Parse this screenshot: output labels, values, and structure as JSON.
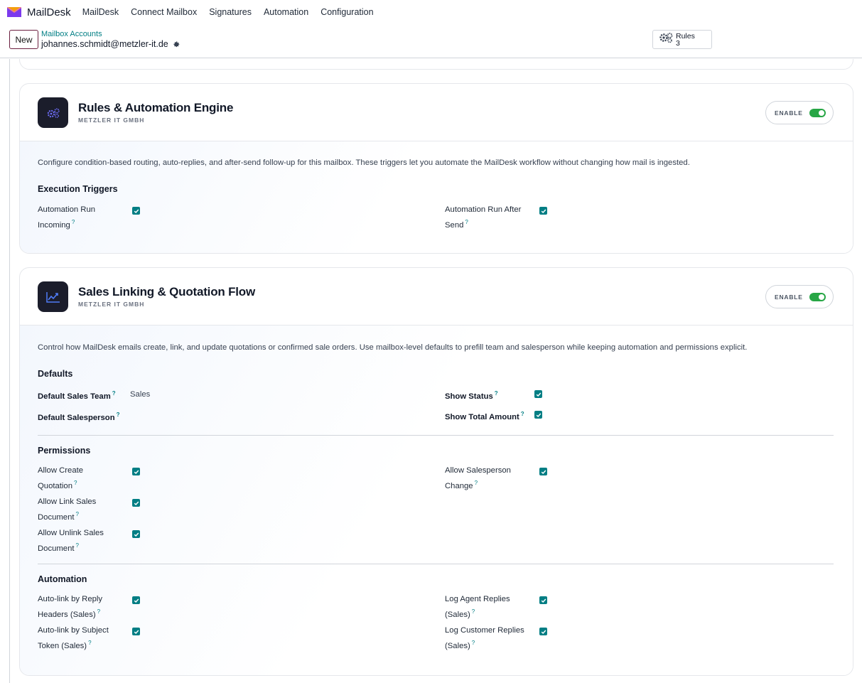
{
  "navbar": {
    "brand": "MailDesk",
    "items": [
      "MailDesk",
      "Connect Mailbox",
      "Signatures",
      "Automation",
      "Configuration"
    ]
  },
  "controlbar": {
    "new_label": "New",
    "breadcrumb": "Mailbox Accounts",
    "record_title": "johannes.schmidt@metzler-it.de",
    "smart_button": {
      "label": "Rules",
      "count": "3"
    }
  },
  "rules_card": {
    "title": "Rules & Automation Engine",
    "subtitle": "METZLER IT GMBH",
    "enable_label": "ENABLE",
    "enabled": true,
    "description": "Configure condition-based routing, auto-replies, and after-send follow-up for this mailbox. These triggers let you automate the MailDesk workflow without changing how mail is ingested.",
    "section": "Execution Triggers",
    "fields": [
      {
        "line1": "Automation Run",
        "line2": "Incoming",
        "checked": true
      },
      {
        "line1": "Automation Run After",
        "line2": "Send",
        "checked": true
      }
    ]
  },
  "sales_card": {
    "title": "Sales Linking & Quotation Flow",
    "subtitle": "METZLER IT GMBH",
    "enable_label": "ENABLE",
    "enabled": true,
    "description": "Control how MailDesk emails create, link, and update quotations or confirmed sale orders. Use mailbox-level defaults to prefill team and salesperson while keeping automation and permissions explicit.",
    "defaults": {
      "title": "Defaults",
      "sales_team_label": "Default Sales Team",
      "sales_team_value": "Sales",
      "salesperson_label": "Default Salesperson",
      "salesperson_value": "",
      "show_status_label": "Show Status",
      "show_total_label": "Show Total Amount"
    },
    "permissions": {
      "title": "Permissions",
      "fields": [
        {
          "line1": "Allow Create",
          "line2": "Quotation",
          "checked": true
        },
        {
          "line1": "Allow Link Sales",
          "line2": "Document",
          "checked": true
        },
        {
          "line1": "Allow Unlink Sales",
          "line2": "Document",
          "checked": true
        },
        {
          "line1": "Allow Salesperson",
          "line2": "Change",
          "checked": true
        }
      ]
    },
    "automation": {
      "title": "Automation",
      "fields": [
        {
          "line1": "Auto-link by Reply",
          "line2": "Headers (Sales)",
          "checked": true
        },
        {
          "line1": "Auto-link by Subject",
          "line2": "Token (Sales)",
          "checked": true
        },
        {
          "line1": "Log Agent Replies",
          "line2": "(Sales)",
          "checked": true
        },
        {
          "line1": "Log Customer Replies",
          "line2": "(Sales)",
          "checked": true
        }
      ]
    }
  },
  "help_marker": "?",
  "colors": {
    "accent": "#017e84",
    "toggle_on": "#27a645",
    "brand": "#6b1f3f",
    "icon_bg": "#1b1d2b"
  }
}
